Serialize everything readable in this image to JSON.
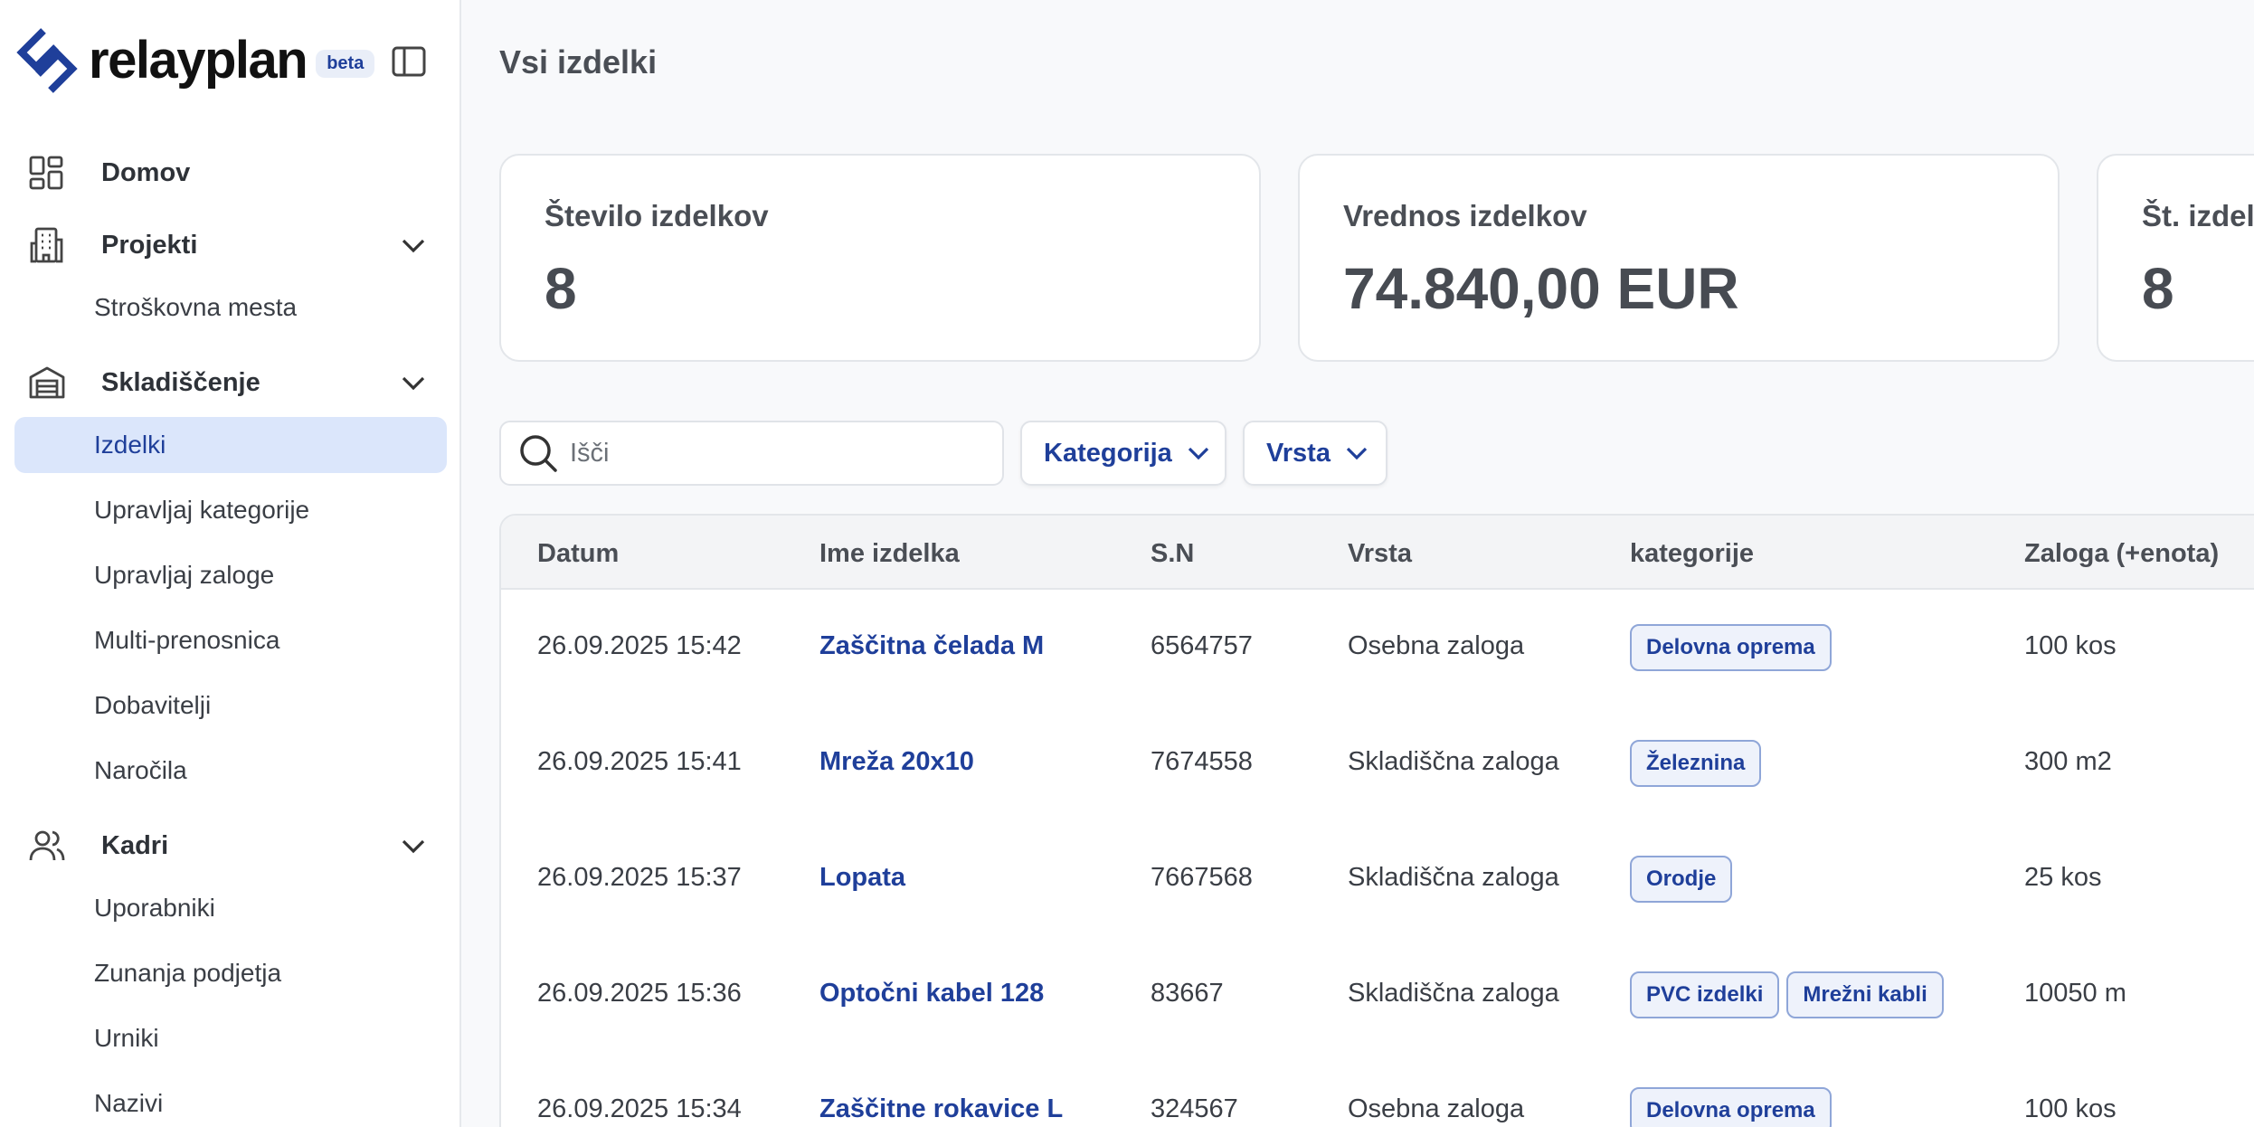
{
  "brand": {
    "name": "relayplan",
    "badge": "beta",
    "accent_color": "#1f3f9a"
  },
  "sidebar": {
    "sections": [
      {
        "label": "Domov",
        "icon": "dashboard-icon",
        "expandable": false
      },
      {
        "label": "Projekti",
        "icon": "building-icon",
        "expandable": true,
        "items": [
          "Stroškovna mesta"
        ]
      },
      {
        "label": "Skladiščenje",
        "icon": "warehouse-icon",
        "expandable": true,
        "items": [
          "Izdelki",
          "Upravljaj kategorije",
          "Upravljaj zaloge",
          "Multi-prenosnica",
          "Dobavitelji",
          "Naročila"
        ],
        "active_item": "Izdelki"
      },
      {
        "label": "Kadri",
        "icon": "users-icon",
        "expandable": true,
        "items": [
          "Uporabniki",
          "Zunanja podjetja",
          "Urniki",
          "Nazivi"
        ]
      }
    ]
  },
  "page": {
    "title": "Vsi izdelki"
  },
  "stats": [
    {
      "label": "Število izdelkov",
      "value": "8"
    },
    {
      "label": "Vrednos izdelkov",
      "value": "74.840,00 EUR"
    },
    {
      "label": "Št. izdel",
      "value": "8"
    }
  ],
  "search": {
    "placeholder": "Išči",
    "value": ""
  },
  "filters": {
    "category_label": "Kategorija",
    "type_label": "Vrsta"
  },
  "table": {
    "headers": [
      "Datum",
      "Ime izdelka",
      "S.N",
      "Vrsta",
      "kategorije",
      "Zaloga (+enota)"
    ],
    "rows": [
      {
        "date": "26.09.2025 15:42",
        "name": "Zaščitna čelada M",
        "sn": "6564757",
        "type": "Osebna zaloga",
        "tags": [
          "Delovna oprema"
        ],
        "stock": "100 kos"
      },
      {
        "date": "26.09.2025 15:41",
        "name": "Mreža 20x10",
        "sn": "7674558",
        "type": "Skladiščna zaloga",
        "tags": [
          "Železnina"
        ],
        "stock": "300 m2"
      },
      {
        "date": "26.09.2025 15:37",
        "name": "Lopata",
        "sn": "7667568",
        "type": "Skladiščna zaloga",
        "tags": [
          "Orodje"
        ],
        "stock": "25 kos"
      },
      {
        "date": "26.09.2025 15:36",
        "name": "Optočni kabel 128",
        "sn": "83667",
        "type": "Skladiščna zaloga",
        "tags": [
          "PVC izdelki",
          "Mrežni kabli"
        ],
        "stock": "10050 m"
      },
      {
        "date": "26.09.2025 15:34",
        "name": "Zaščitne rokavice L",
        "sn": "324567",
        "type": "Osebna zaloga",
        "tags": [
          "Delovna oprema"
        ],
        "stock": "100 kos"
      }
    ]
  }
}
